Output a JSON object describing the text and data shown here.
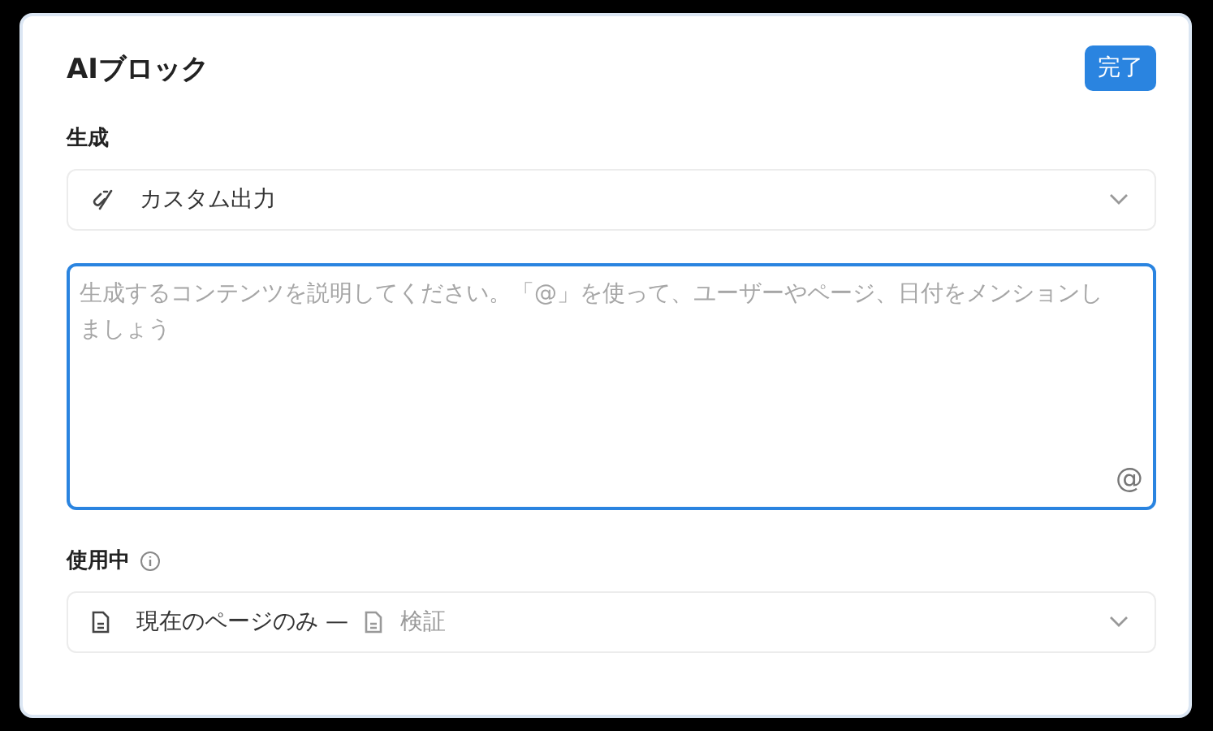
{
  "title": "AIブロック",
  "done_button": "完了",
  "generate": {
    "label": "生成",
    "select": {
      "value": "カスタム出力"
    }
  },
  "prompt": {
    "placeholder": "生成するコンテンツを説明してください。「@」を使って、ユーザーやページ、日付をメンションしましょう",
    "focused": true,
    "mention_button": "@"
  },
  "usage": {
    "label": "使用中",
    "select": {
      "value": "現在のページのみ —",
      "page": "検証"
    }
  }
}
